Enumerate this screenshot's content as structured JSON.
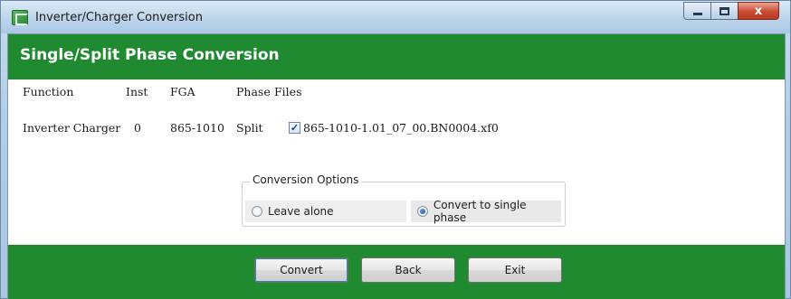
{
  "window": {
    "title": "Inverter/Charger Conversion",
    "controls": {
      "close": "x"
    }
  },
  "banner": {
    "title": "Single/Split Phase Conversion"
  },
  "table": {
    "headers": [
      "Function",
      "Inst",
      "FGA",
      "Phase",
      "Files"
    ],
    "rows": [
      {
        "function": "Inverter Charger",
        "inst": "0",
        "fga": "865-1010",
        "phase": "Split",
        "file": "865-1010-1.01_07_00.BN0004.xf0",
        "file_checked": true
      }
    ]
  },
  "conversion_options": {
    "legend": "Conversion Options",
    "options": [
      {
        "label": "Leave alone",
        "selected": false
      },
      {
        "label": "Convert to single phase",
        "selected": true
      }
    ]
  },
  "buttons": {
    "convert": "Convert",
    "back": "Back",
    "exit": "Exit"
  },
  "colors": {
    "accent_green": "#1f8a2f",
    "close_red": "#c84b32"
  },
  "icons": {
    "app": "inverter-app-icon",
    "minimize": "minimize-icon",
    "maximize": "maximize-icon",
    "close": "close-icon"
  }
}
